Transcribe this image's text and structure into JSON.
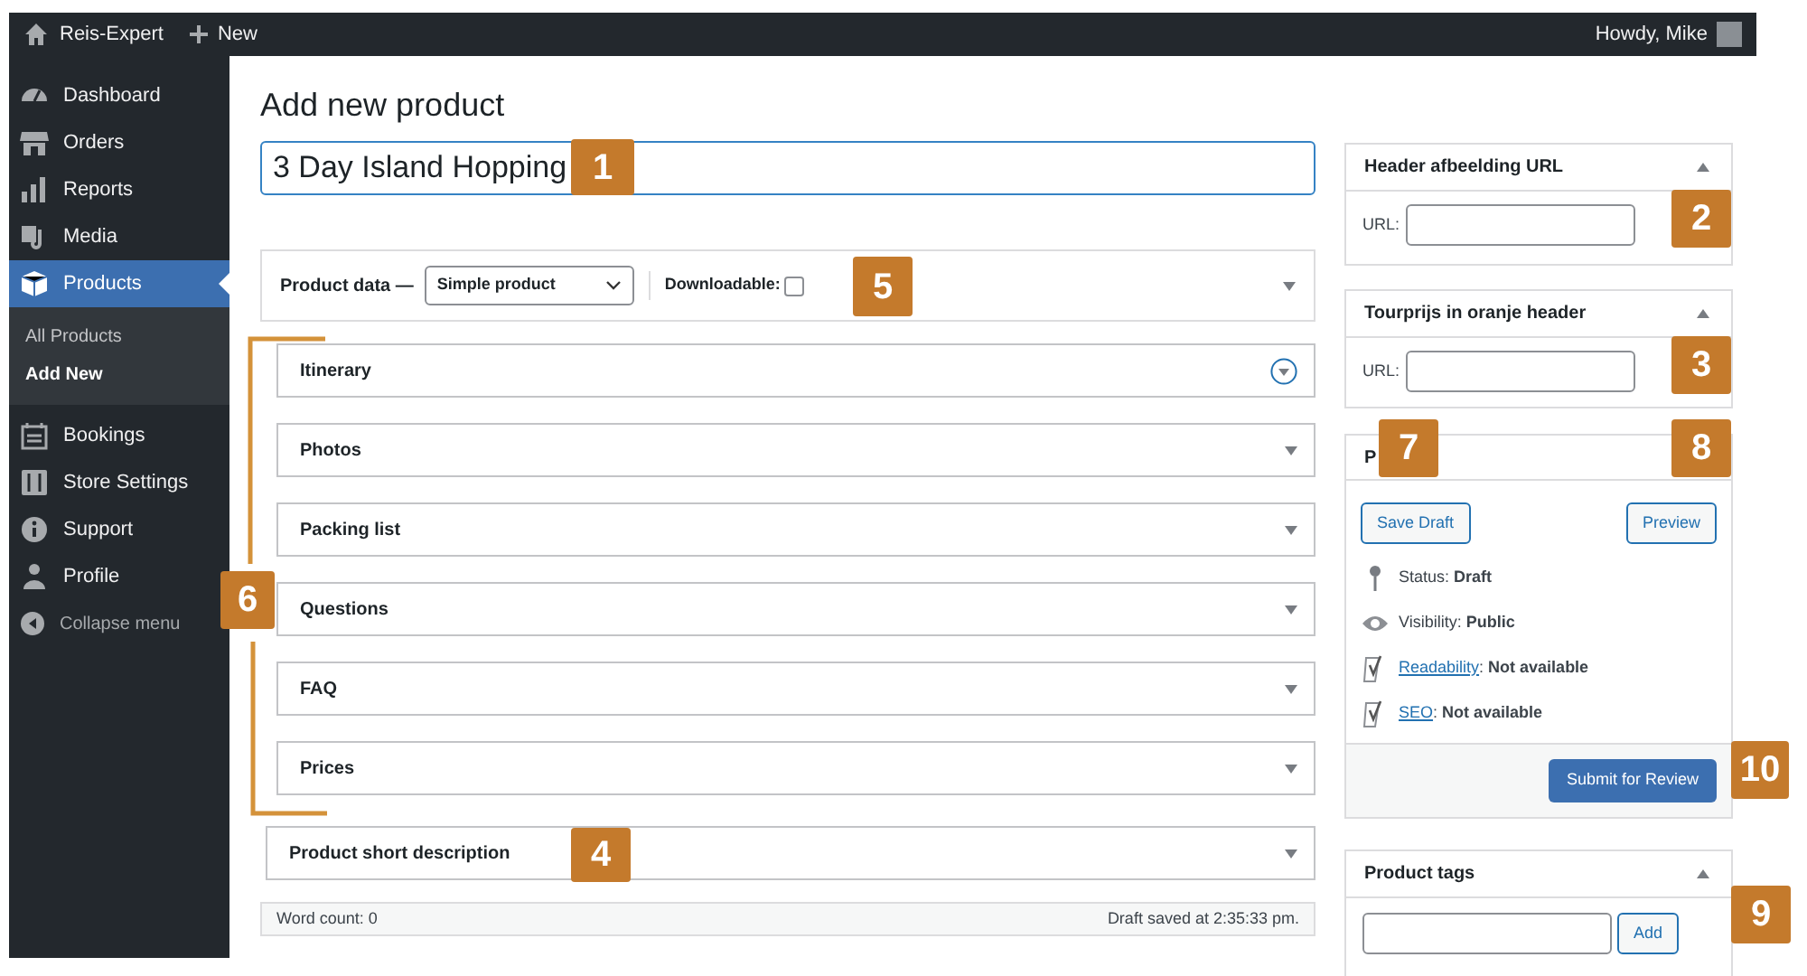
{
  "admin_bar": {
    "site_name": "Reis-Expert",
    "new_label": "New",
    "greeting": "Howdy, Mike"
  },
  "sidebar": {
    "items": [
      {
        "label": "Dashboard",
        "kind": "dashboard",
        "selected": false
      },
      {
        "label": "Orders",
        "kind": "store",
        "selected": false
      },
      {
        "label": "Reports",
        "kind": "bars",
        "selected": false
      },
      {
        "label": "Media",
        "kind": "media",
        "selected": false
      },
      {
        "label": "Products",
        "kind": "box",
        "selected": true,
        "children": [
          {
            "label": "All Products",
            "selected": false
          },
          {
            "label": "Add New",
            "selected": true
          }
        ]
      },
      {
        "label": "Bookings",
        "kind": "calendar",
        "selected": false
      },
      {
        "label": "Store Settings",
        "kind": "settings",
        "selected": false
      },
      {
        "label": "Support",
        "kind": "info",
        "selected": false
      },
      {
        "label": "Profile",
        "kind": "person",
        "selected": false
      }
    ],
    "collapse_label": "Collapse menu"
  },
  "page_title": "Add new product",
  "product_title": "3 Day Island Hopping",
  "product_data": {
    "label": "Product data —",
    "type": "Simple product",
    "downloadable_label": "Downloadable:",
    "downloadable": false
  },
  "panels": [
    {
      "title": "Itinerary",
      "highlighted": true
    },
    {
      "title": "Photos",
      "highlighted": false
    },
    {
      "title": "Packing list",
      "highlighted": false
    },
    {
      "title": "Questions",
      "highlighted": false
    },
    {
      "title": "FAQ",
      "highlighted": false
    },
    {
      "title": "Prices",
      "highlighted": false
    }
  ],
  "short_description": {
    "title": "Product short description"
  },
  "status_bar": {
    "word_count": "Word count: 0",
    "saved": "Draft saved at 2:35:33 pm."
  },
  "url_boxes": [
    {
      "title": "Header afbeelding URL",
      "field_label": "URL:"
    },
    {
      "title": "Tourprijs in oranje header",
      "field_label": "URL:"
    }
  ],
  "publish": {
    "title": "P",
    "save_draft": "Save Draft",
    "preview": "Preview",
    "rows": [
      {
        "kind": "pin",
        "text": "Status: **Draft**"
      },
      {
        "kind": "eye",
        "text": "Visibility: **Public**"
      },
      {
        "kind": "yoast",
        "link": "Readability",
        "text": ": **Not available**"
      },
      {
        "kind": "yoast",
        "link": "SEO",
        "text": ": **Not available**"
      }
    ],
    "submit": "Submit for Review"
  },
  "tags": {
    "title": "Product tags",
    "add": "Add"
  },
  "callouts": [
    "1",
    "2",
    "3",
    "4",
    "5",
    "6",
    "7",
    "8",
    "9",
    "10"
  ]
}
